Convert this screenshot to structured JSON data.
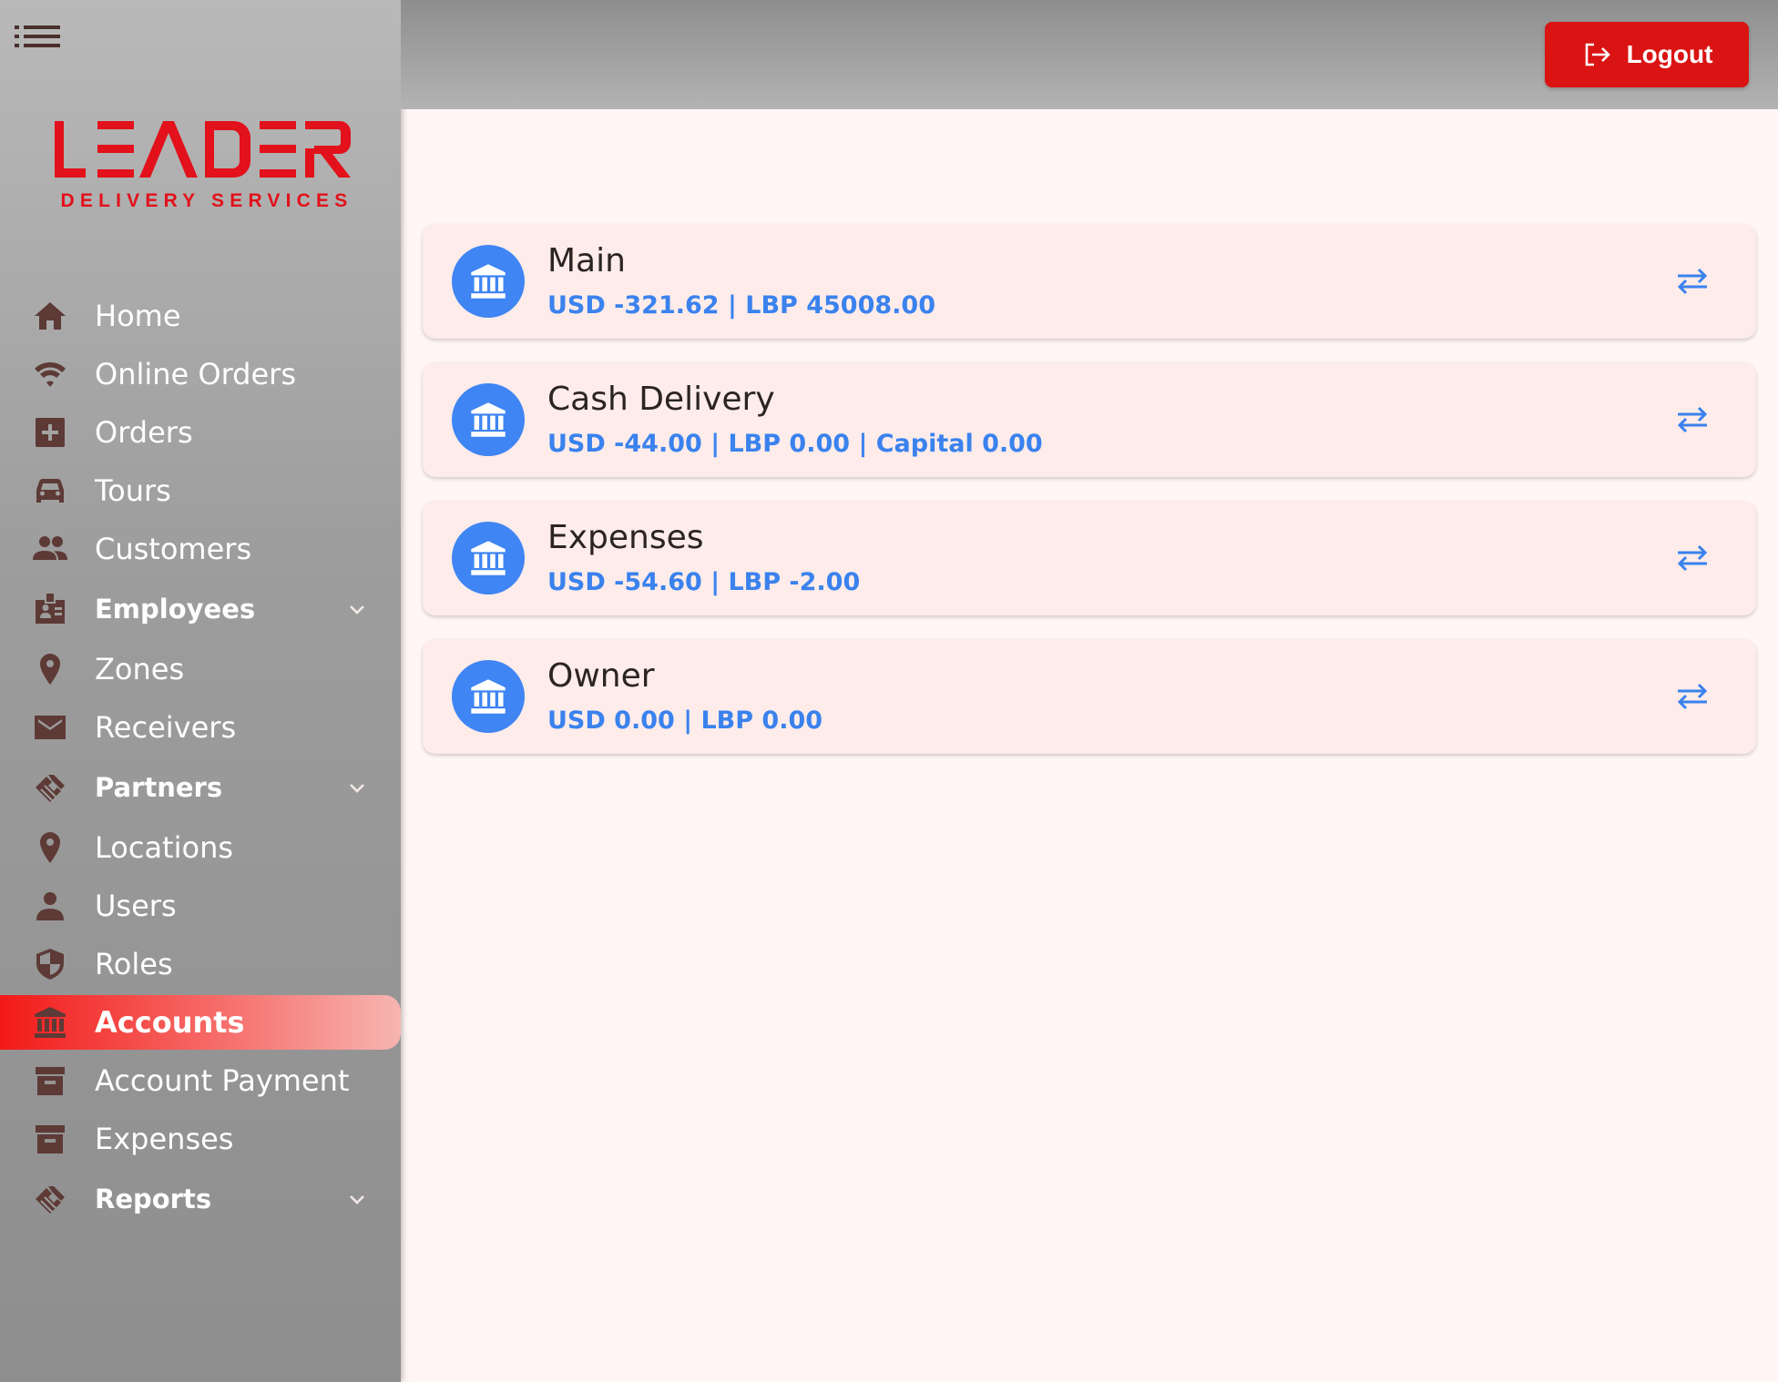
{
  "brand": {
    "name": "LEADER",
    "tagline": "DELIVERY SERVICES",
    "color": "#e2111b"
  },
  "header": {
    "logout_label": "Logout"
  },
  "sidebar": {
    "items": [
      {
        "label": "Home",
        "icon": "home-icon"
      },
      {
        "label": "Online Orders",
        "icon": "wifi-icon"
      },
      {
        "label": "Orders",
        "icon": "plus-box-icon"
      },
      {
        "label": "Tours",
        "icon": "car-icon"
      },
      {
        "label": "Customers",
        "icon": "people-icon"
      },
      {
        "label": "Employees",
        "icon": "badge-icon",
        "group": true
      },
      {
        "label": "Zones",
        "icon": "pin-icon"
      },
      {
        "label": "Receivers",
        "icon": "mail-icon"
      },
      {
        "label": "Partners",
        "icon": "handshake-icon",
        "group": true
      },
      {
        "label": "Locations",
        "icon": "pin-icon"
      },
      {
        "label": "Users",
        "icon": "person-icon"
      },
      {
        "label": "Roles",
        "icon": "shield-icon"
      },
      {
        "label": "Accounts",
        "icon": "bank-icon",
        "active": true
      },
      {
        "label": "Account Payment",
        "icon": "archive-icon"
      },
      {
        "label": "Expenses",
        "icon": "archive-icon"
      },
      {
        "label": "Reports",
        "icon": "handshake-icon",
        "group": true
      }
    ]
  },
  "accounts": [
    {
      "name": "Main",
      "balance": "USD -321.62 | LBP 45008.00"
    },
    {
      "name": "Cash Delivery",
      "balance": "USD -44.00 | LBP 0.00 | Capital 0.00"
    },
    {
      "name": "Expenses",
      "balance": "USD -54.60 | LBP -2.00"
    },
    {
      "name": "Owner",
      "balance": "USD 0.00 | LBP 0.00"
    }
  ],
  "colors": {
    "accent": "#3f85f3",
    "danger": "#d91412",
    "icon": "#5d3a36"
  }
}
